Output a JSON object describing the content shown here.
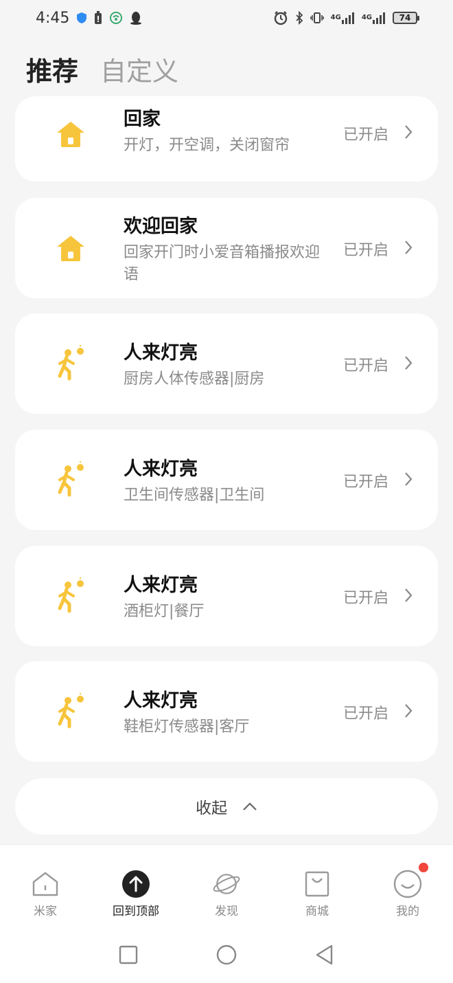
{
  "status_bar": {
    "time": "4:45",
    "net_label_1": "4G",
    "net_label_2": "4G",
    "battery": "74"
  },
  "header": {
    "tabs": [
      {
        "label": "推荐",
        "active": true
      },
      {
        "label": "自定义",
        "active": false
      }
    ]
  },
  "scenes": [
    {
      "icon": "house-icon",
      "title": "回家",
      "desc": "开灯，开空调，关闭窗帘",
      "status": "已开启"
    },
    {
      "icon": "house-icon",
      "title": "欢迎回家",
      "desc": "回家开门时小爱音箱播报欢迎语",
      "status": "已开启"
    },
    {
      "icon": "person-walking-light-icon",
      "title": "人来灯亮",
      "desc": "厨房人体传感器|厨房",
      "status": "已开启"
    },
    {
      "icon": "person-walking-light-icon",
      "title": "人来灯亮",
      "desc": "卫生间传感器|卫生间",
      "status": "已开启"
    },
    {
      "icon": "person-walking-light-icon",
      "title": "人来灯亮",
      "desc": "酒柜灯|餐厅",
      "status": "已开启"
    },
    {
      "icon": "person-walking-light-icon",
      "title": "人来灯亮",
      "desc": "鞋柜灯传感器|客厅",
      "status": "已开启"
    }
  ],
  "collapse": {
    "label": "收起"
  },
  "bottom_nav": [
    {
      "icon": "home-icon",
      "label": "米家",
      "active": false
    },
    {
      "icon": "arrow-up-icon",
      "label": "回到顶部",
      "active": true
    },
    {
      "icon": "planet-icon",
      "label": "发现",
      "active": false
    },
    {
      "icon": "shopping-bag-icon",
      "label": "商城",
      "active": false
    },
    {
      "icon": "smile-icon",
      "label": "我的",
      "active": false,
      "badge": true
    }
  ],
  "colors": {
    "accent_yellow": "#F7C53C",
    "badge_red": "#F0463C",
    "background": "#F5F5F5"
  }
}
